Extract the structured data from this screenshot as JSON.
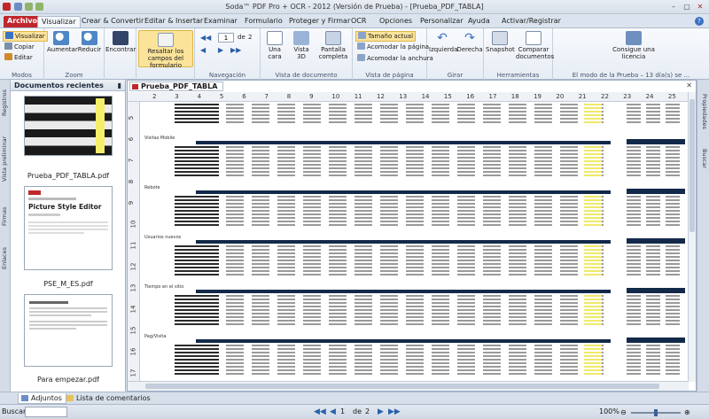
{
  "titlebar": {
    "title": "Soda™ PDF Pro + OCR - 2012 (Versión de Prueba) - [Prueba_PDF_TABLA]",
    "controls": [
      "–",
      "▢",
      "✕"
    ]
  },
  "menu": [
    "Archivo",
    "Visualizar",
    "Crear & Convertir",
    "Editar & Insertar",
    "Examinar",
    "Formulario",
    "Proteger y Firmar",
    "OCR",
    "Opciones",
    "Personalizar",
    "Ayuda",
    "Activar/Registrar"
  ],
  "ribbon": {
    "modos": {
      "label": "Modos",
      "visualizar": "Visualizar",
      "copiar": "Copiar",
      "editar": "Editar"
    },
    "zoom": {
      "label": "Zoom",
      "aumentar": "Aumentar",
      "reducir": "Reducir"
    },
    "encontrar": "Encontrar",
    "resaltar": "Resaltar los campos del formulario",
    "navegacion": {
      "label": "Navegación",
      "page": "1",
      "of": "de",
      "total": "2"
    },
    "vista_doc": {
      "label": "Vista de documento",
      "una_cara": "Una cara",
      "vista3d": "Vista 3D",
      "pantalla": "Pantalla completa"
    },
    "vista_pag": {
      "label": "Vista de página",
      "tamano": "Tamaño actual",
      "acomodar_pag": "Acomodar la página",
      "acomodar_anch": "Acomodar la anchura"
    },
    "girar": {
      "label": "Girar",
      "izquierda": "Izquierda",
      "derecha": "Derecha"
    },
    "herramientas": {
      "label": "Herramientas",
      "snapshot": "Snapshot",
      "comparar": "Comparar documentos"
    },
    "licencia": {
      "label": "El modo de la Prueba – 13 día(s) se ...",
      "consigue": "Consigue una licencia"
    }
  },
  "left_tabs": [
    "Registros",
    "Vista preliminar",
    "Firmas",
    "Enlaces"
  ],
  "doc_panel": {
    "title": "Documentos recientes",
    "files": [
      {
        "name": "Prueba_PDF_TABLA.pdf"
      },
      {
        "name": "PSE_M_ES.pdf",
        "thumb_text": "Picture Style Editor"
      },
      {
        "name": "Para empezar.pdf"
      }
    ]
  },
  "document": {
    "tab": "Prueba_PDF_TABLA",
    "columns": [
      "2",
      "3",
      "4",
      "5",
      "6",
      "7",
      "8",
      "9",
      "10",
      "11",
      "12",
      "13",
      "14",
      "15",
      "16",
      "17",
      "18",
      "19",
      "20",
      "21",
      "22",
      "23",
      "24",
      "25"
    ],
    "rows": [
      "5",
      "6",
      "7",
      "8",
      "9",
      "10",
      "11",
      "12",
      "13",
      "14",
      "15",
      "16",
      "17"
    ],
    "sections": [
      "Visitas Mobile",
      "Rebote",
      "Usuarios nuevos",
      "Tiempo en el sitio",
      "Pag/Visita"
    ]
  },
  "right_tabs": [
    "Propiedades",
    "Buscar"
  ],
  "bottom_tabs": {
    "adjuntos": "Adjuntos",
    "comentarios": "Lista de comentarios"
  },
  "status": {
    "buscar": "Buscar",
    "page": "1",
    "of": "de",
    "total": "2",
    "zoom": "100%"
  },
  "colors": {
    "accent": "#c0272d",
    "highlight": "#fbe39a",
    "header": "#13294a"
  }
}
